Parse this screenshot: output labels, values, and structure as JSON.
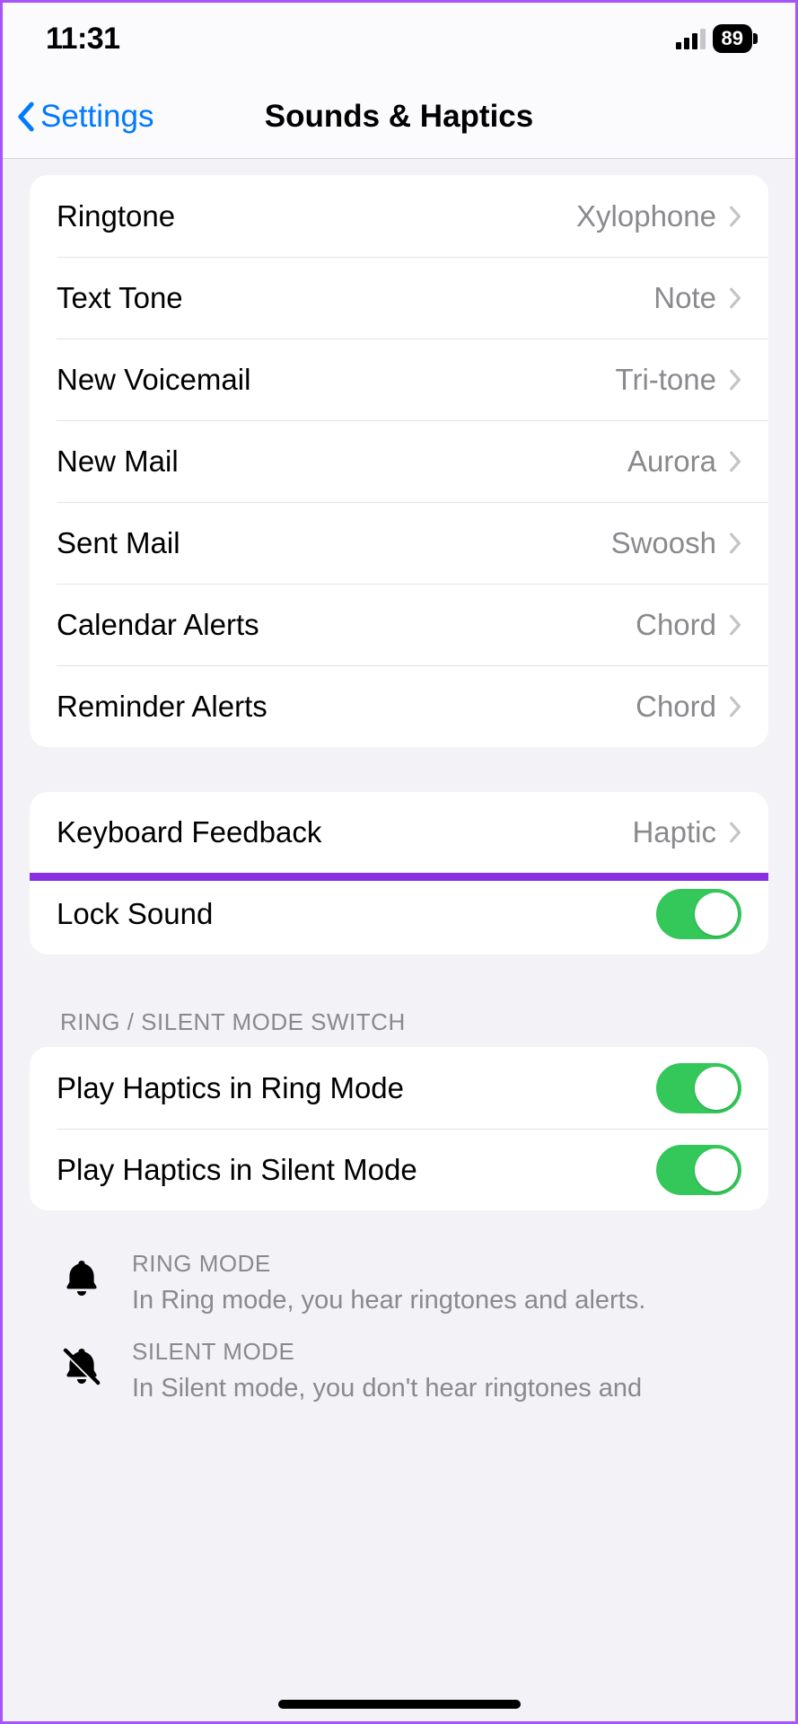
{
  "status": {
    "time": "11:31",
    "battery": "89"
  },
  "nav": {
    "back_label": "Settings",
    "title": "Sounds & Haptics"
  },
  "sounds": {
    "items": [
      {
        "label": "Ringtone",
        "value": "Xylophone"
      },
      {
        "label": "Text Tone",
        "value": "Note"
      },
      {
        "label": "New Voicemail",
        "value": "Tri-tone"
      },
      {
        "label": "New Mail",
        "value": "Aurora"
      },
      {
        "label": "Sent Mail",
        "value": "Swoosh"
      },
      {
        "label": "Calendar Alerts",
        "value": "Chord"
      },
      {
        "label": "Reminder Alerts",
        "value": "Chord"
      }
    ]
  },
  "system": {
    "keyboard_feedback": {
      "label": "Keyboard Feedback",
      "value": "Haptic"
    },
    "lock_sound": {
      "label": "Lock Sound"
    }
  },
  "ring_section": {
    "header": "RING / SILENT MODE SWITCH",
    "ring_haptics": {
      "label": "Play Haptics in Ring Mode"
    },
    "silent_haptics": {
      "label": "Play Haptics in Silent Mode"
    }
  },
  "notes": {
    "ring": {
      "title": "RING MODE",
      "desc": "In Ring mode, you hear ringtones and alerts."
    },
    "silent": {
      "title": "SILENT MODE",
      "desc": "In Silent mode, you don't hear ringtones and"
    }
  }
}
